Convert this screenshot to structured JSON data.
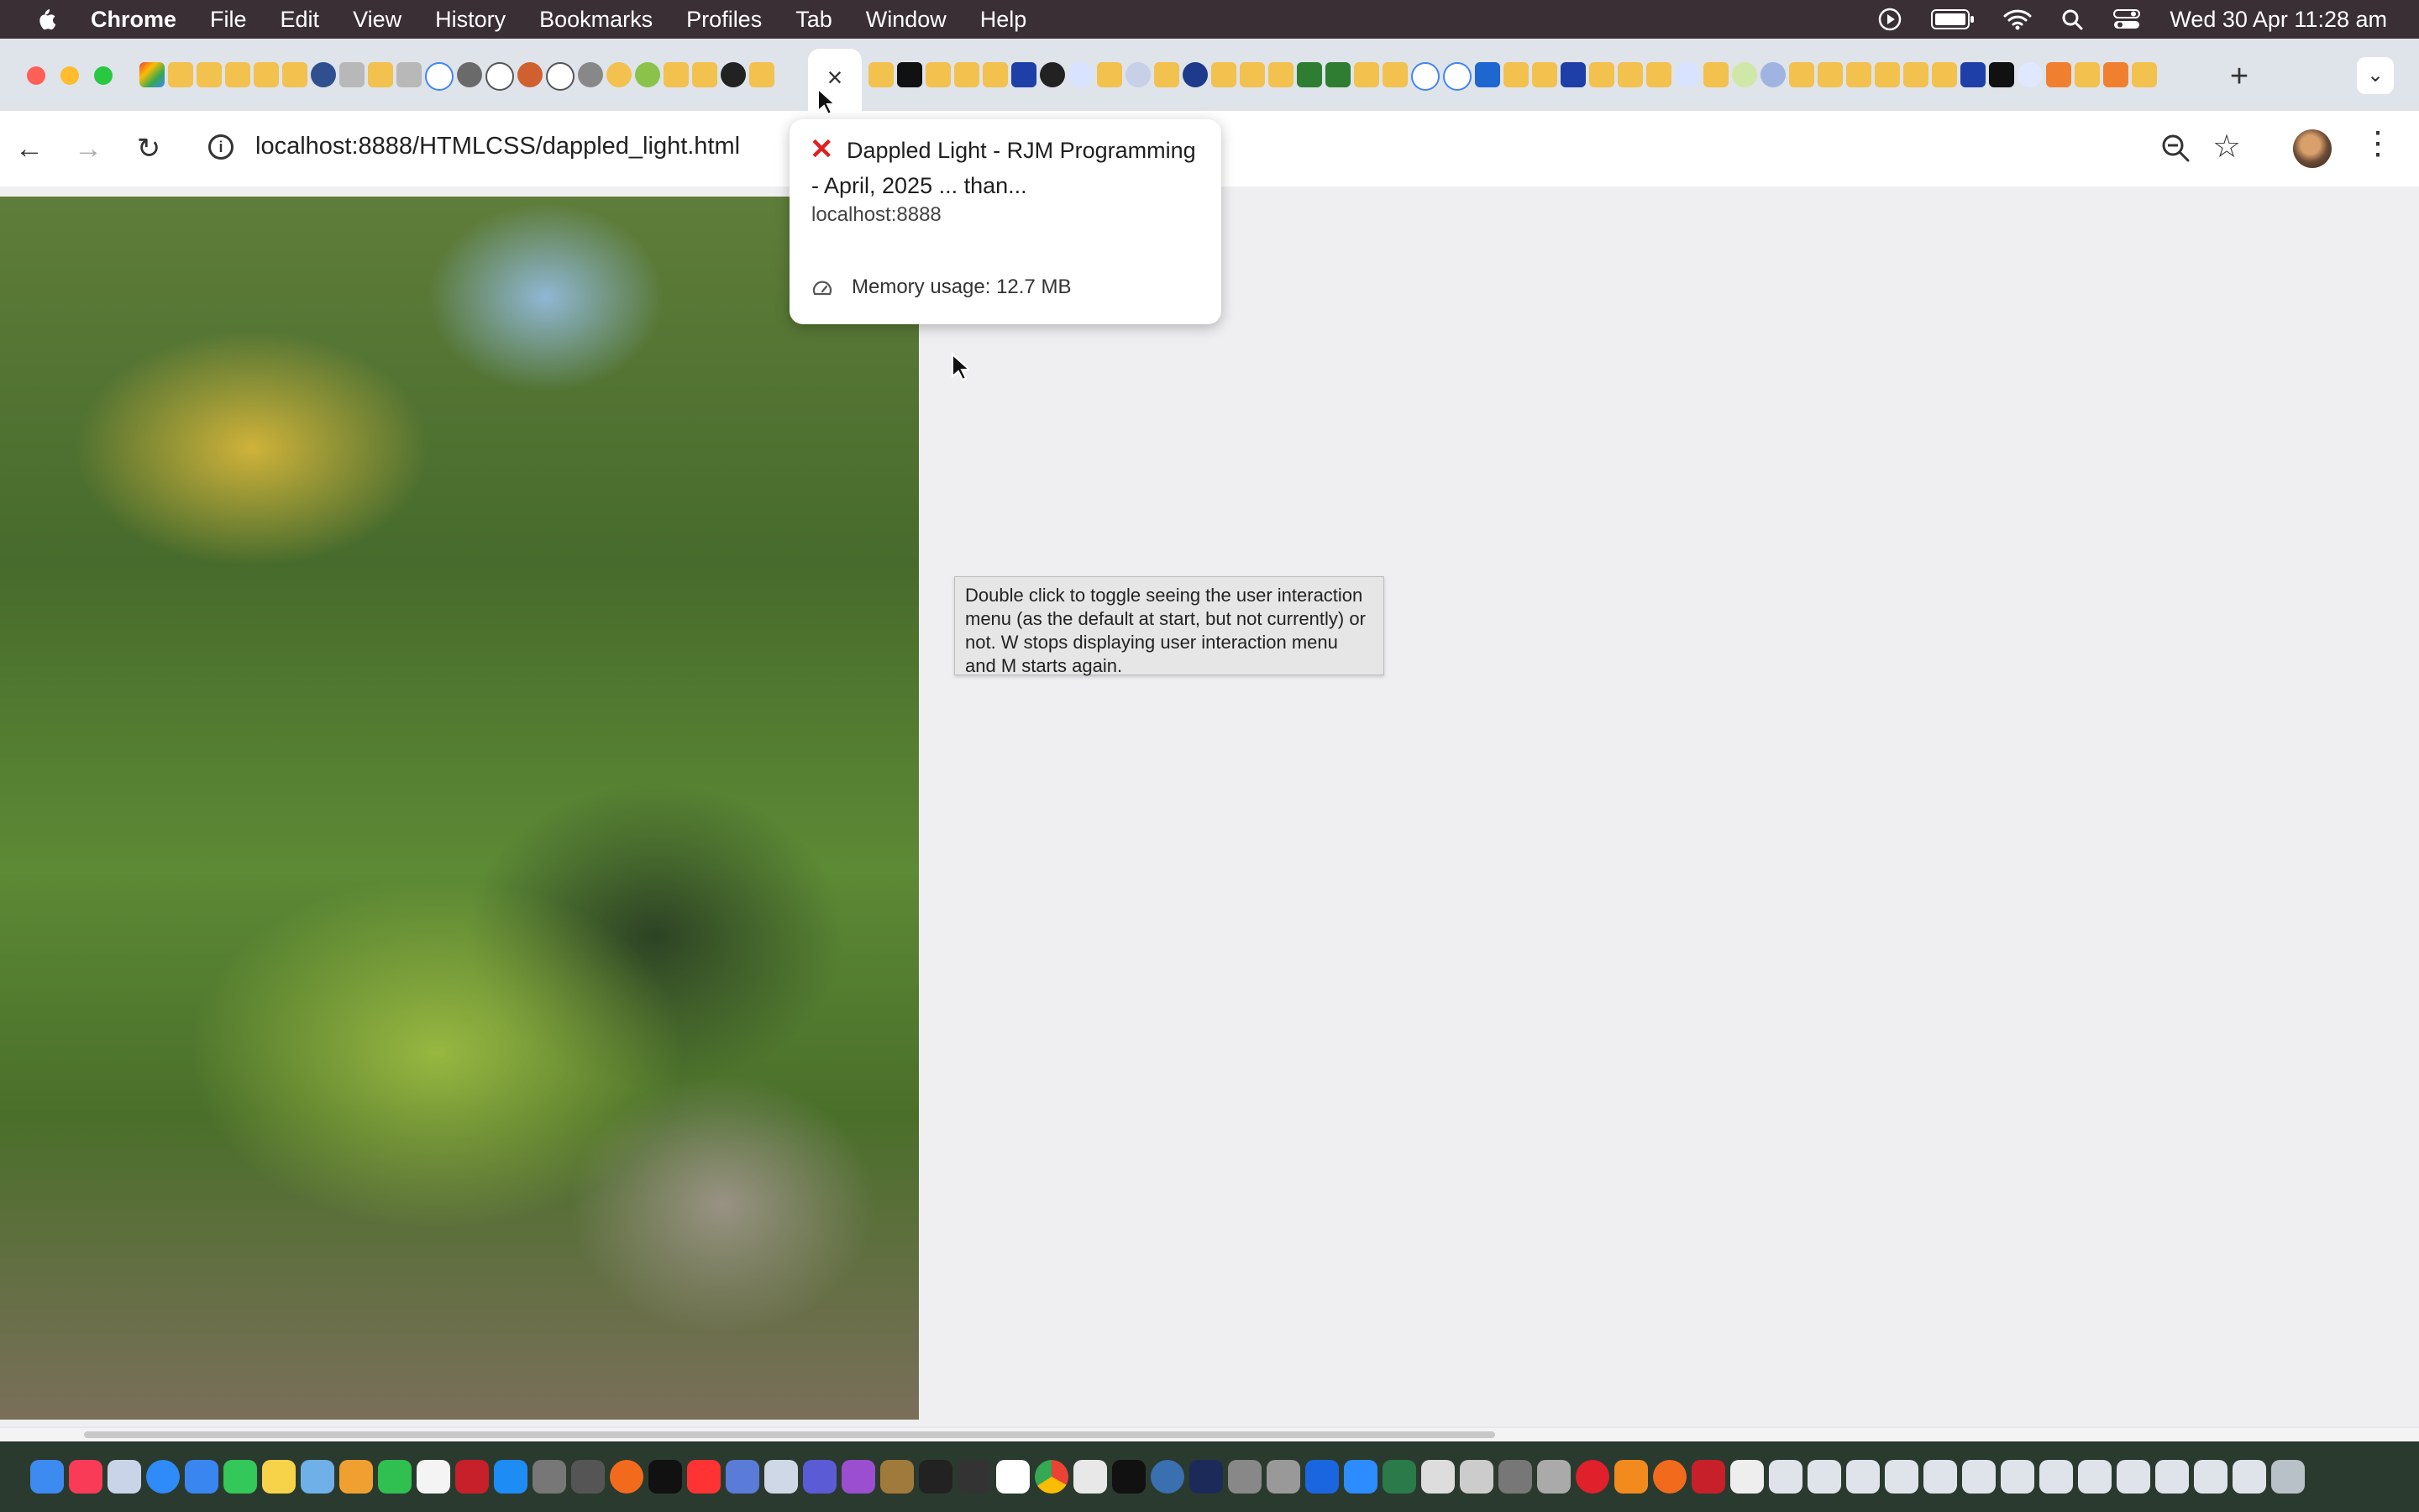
{
  "menubar": {
    "app_name": "Chrome",
    "menus": [
      "File",
      "Edit",
      "View",
      "History",
      "Bookmarks",
      "Profiles",
      "Tab",
      "Window",
      "Help"
    ],
    "clock": "Wed 30 Apr  11:28 am"
  },
  "tabs": {
    "active_close_glyph": "×",
    "new_tab_glyph": "+",
    "tab_search_glyph": "⌄"
  },
  "toolbar": {
    "url": "localhost:8888/HTMLCSS/dappled_light.html",
    "back_glyph": "←",
    "forward_glyph": "→",
    "reload_glyph": "↻",
    "info_glyph": "i",
    "bookmark_glyph": "☆",
    "menu_glyph": "⋮"
  },
  "hover_card": {
    "title": "Dappled Light - RJM Programming - April, 2025 ... than...",
    "host": "localhost:8888",
    "memory": "Memory usage: 12.7 MB",
    "error_glyph": "✕"
  },
  "tooltip": {
    "text": "Double click to toggle seeing the user interaction menu (as the default at start, but not currently) or not.  W stops displaying user interaction menu and M starts again."
  },
  "colors": {
    "menubar_bg": "#3b2f36",
    "tabstrip_bg": "#dfe3ea",
    "page_bg": "#efeff2",
    "close_red": "#e02020"
  }
}
